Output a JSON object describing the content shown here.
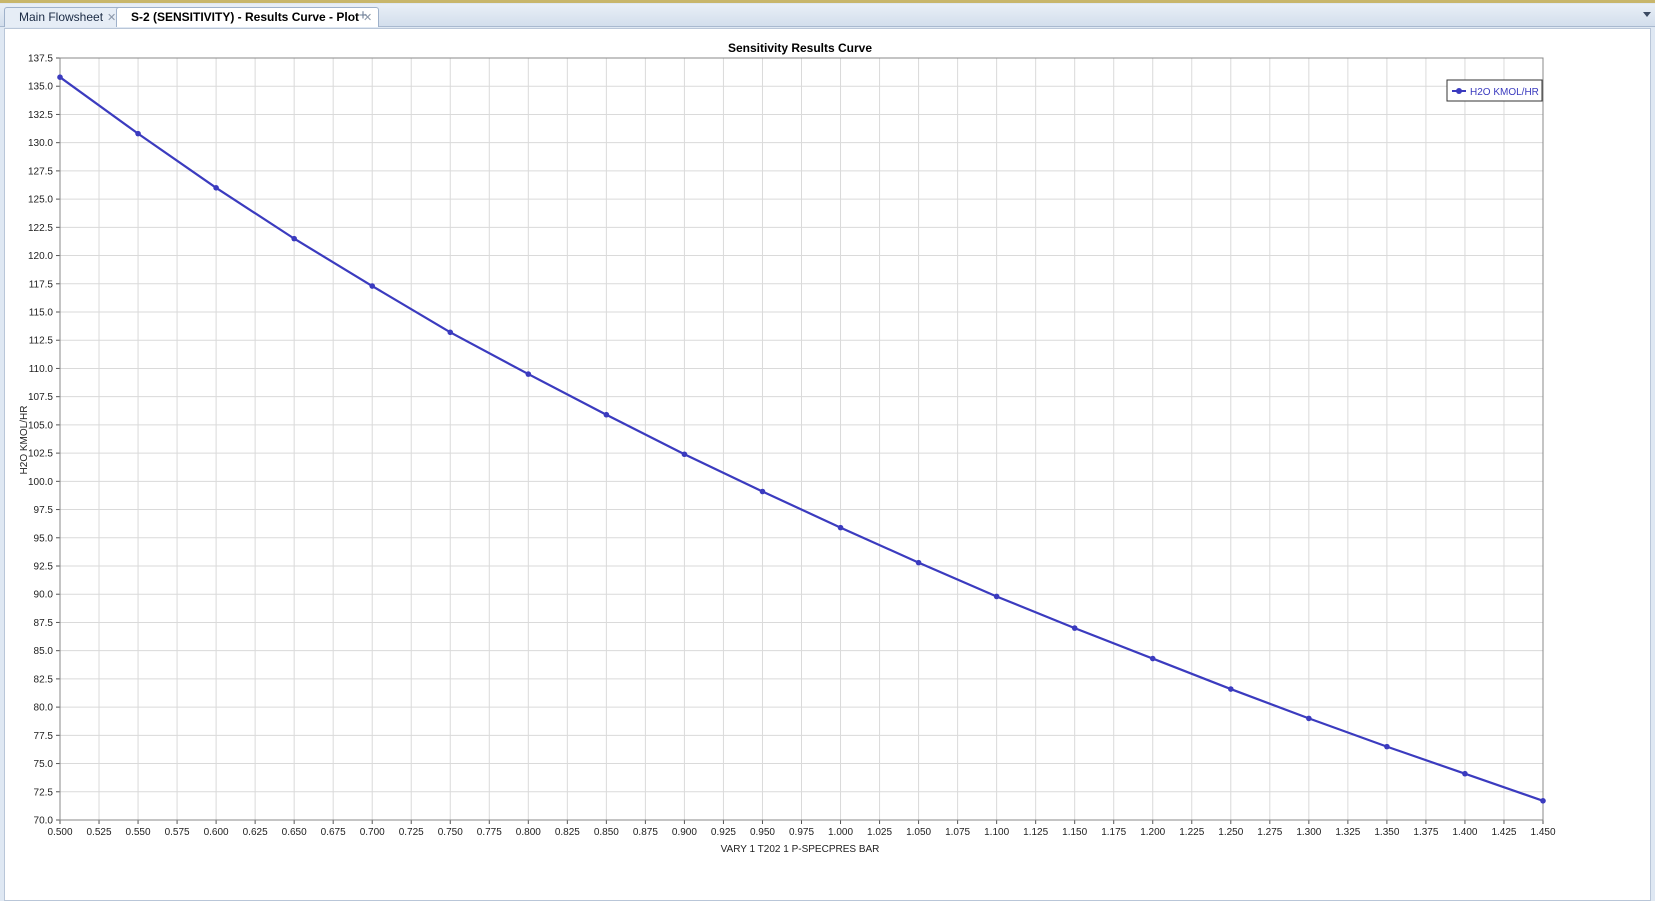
{
  "tabs": [
    {
      "label": "Main Flowsheet",
      "active": false
    },
    {
      "label": "S-2 (SENSITIVITY) - Results Curve - Plot",
      "active": true
    }
  ],
  "tab_add_icon": "plus-icon",
  "close_icon": "close-icon",
  "colors": {
    "series": "#3b3bbf",
    "grid": "#dadada"
  },
  "chart_data": {
    "type": "line",
    "title": "Sensitivity Results Curve",
    "xlabel": "VARY   1 T202 1 P-SPECPRES BAR",
    "ylabel": "H2O KMOL/HR",
    "xlim": [
      0.5,
      1.45
    ],
    "ylim": [
      70.0,
      137.5
    ],
    "x_ticks": [
      "0.500",
      "0.525",
      "0.550",
      "0.575",
      "0.600",
      "0.625",
      "0.650",
      "0.675",
      "0.700",
      "0.725",
      "0.750",
      "0.775",
      "0.800",
      "0.825",
      "0.850",
      "0.875",
      "0.900",
      "0.925",
      "0.950",
      "0.975",
      "1.000",
      "1.025",
      "1.050",
      "1.075",
      "1.100",
      "1.125",
      "1.150",
      "1.175",
      "1.200",
      "1.225",
      "1.250",
      "1.275",
      "1.300",
      "1.325",
      "1.350",
      "1.375",
      "1.400",
      "1.425",
      "1.450"
    ],
    "y_ticks": [
      "137.5",
      "135.0",
      "132.5",
      "130.0",
      "127.5",
      "125.0",
      "122.5",
      "120.0",
      "117.5",
      "115.0",
      "112.5",
      "110.0",
      "107.5",
      "105.0",
      "102.5",
      "100.0",
      "97.5",
      "95.0",
      "92.5",
      "90.0",
      "87.5",
      "85.0",
      "82.5",
      "80.0",
      "77.5",
      "75.0",
      "72.5",
      "70.0"
    ],
    "grid": true,
    "legend_position": "top-right",
    "series": [
      {
        "name": "H2O KMOL/HR",
        "x": [
          0.5,
          0.55,
          0.6,
          0.65,
          0.7,
          0.75,
          0.8,
          0.85,
          0.9,
          0.95,
          1.0,
          1.05,
          1.1,
          1.15,
          1.2,
          1.25,
          1.3,
          1.35,
          1.4,
          1.45
        ],
        "y": [
          135.8,
          130.8,
          126.0,
          121.5,
          117.3,
          113.2,
          109.5,
          105.9,
          102.4,
          99.1,
          95.9,
          92.8,
          89.8,
          87.0,
          84.3,
          81.6,
          79.0,
          76.5,
          74.1,
          71.7
        ]
      }
    ]
  }
}
